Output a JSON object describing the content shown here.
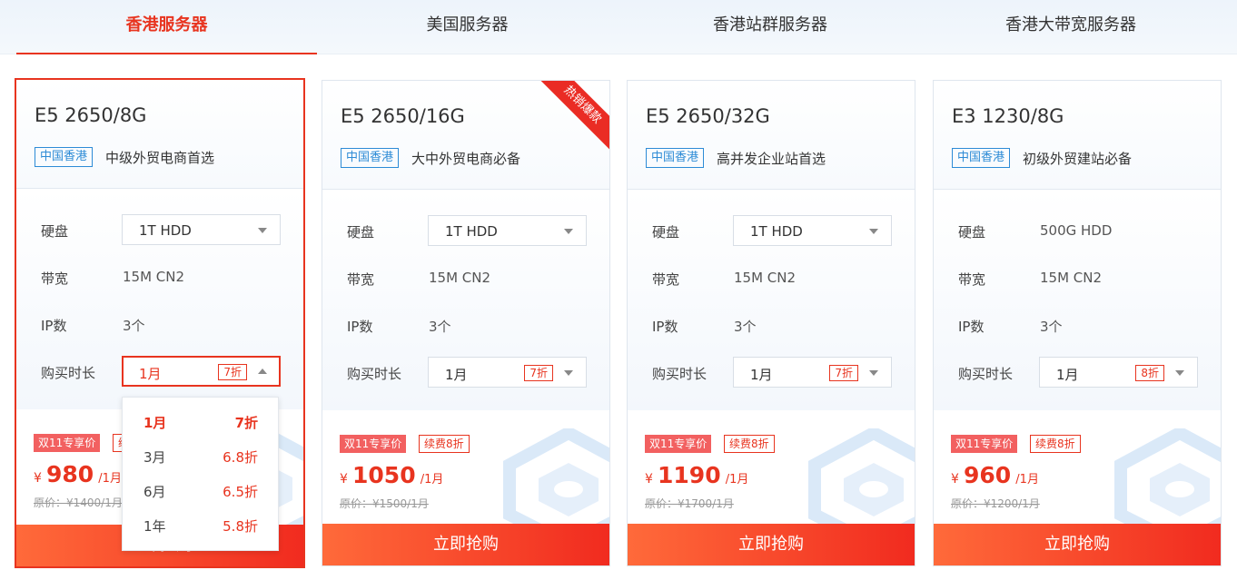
{
  "tabs": [
    "香港服务器",
    "美国服务器",
    "香港站群服务器",
    "香港大带宽服务器"
  ],
  "labels": {
    "disk": "硬盘",
    "bandwidth": "带宽",
    "ip": "IP数",
    "duration": "购买时长",
    "buy": "立即抢购",
    "region": "中国香港",
    "sale": "双11专享价",
    "renew": "续费8折",
    "currency": "¥",
    "per_month": "/1月",
    "hot": "热销爆款"
  },
  "cards": [
    {
      "model": "E5 2650/8G",
      "desc": "中级外贸电商首选",
      "disk": "1T HDD",
      "bandwidth": "15M CN2",
      "ip": "3个",
      "duration": "1月",
      "discount": "7折",
      "price": "980",
      "original": "原价：¥1400/1月"
    },
    {
      "model": "E5 2650/16G",
      "desc": "大中外贸电商必备",
      "disk": "1T HDD",
      "bandwidth": "15M CN2",
      "ip": "3个",
      "duration": "1月",
      "discount": "7折",
      "price": "1050",
      "original": "原价：¥1500/1月"
    },
    {
      "model": "E5 2650/32G",
      "desc": "高并发企业站首选",
      "disk": "1T HDD",
      "bandwidth": "15M CN2",
      "ip": "3个",
      "duration": "1月",
      "discount": "7折",
      "price": "1190",
      "original": "原价：¥1700/1月"
    },
    {
      "model": "E3 1230/8G",
      "desc": "初级外贸建站必备",
      "disk": "500G HDD",
      "bandwidth": "15M CN2",
      "ip": "3个",
      "duration": "1月",
      "discount": "8折",
      "price": "960",
      "original": "原价：¥1200/1月"
    }
  ],
  "duration_options": [
    {
      "label": "1月",
      "discount": "7折"
    },
    {
      "label": "3月",
      "discount": "6.8折"
    },
    {
      "label": "6月",
      "discount": "6.5折"
    },
    {
      "label": "1年",
      "discount": "5.8折"
    }
  ],
  "colors": {
    "accent": "#e8341f",
    "region": "#2d8bd6",
    "sale_badge": "#f26060"
  }
}
